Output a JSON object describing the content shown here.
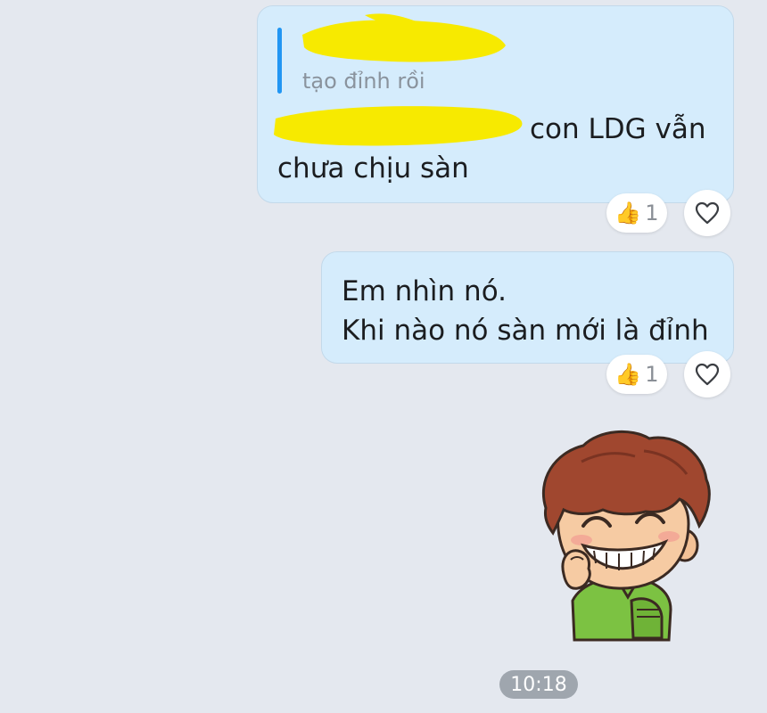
{
  "messages": [
    {
      "quote": {
        "preview_text": "tạo đỉnh rồi"
      },
      "body_lines": [
        "con LDG vẫn",
        "chưa chịu sàn"
      ],
      "reaction": {
        "emoji": "👍",
        "count": "1"
      }
    },
    {
      "body_lines": [
        "Em nhìn nó.",
        "Khi nào nó sàn mới là đỉnh"
      ],
      "reaction": {
        "emoji": "👍",
        "count": "1"
      }
    }
  ],
  "sticker": {
    "icon": "laughing-boy-sticker"
  },
  "timestamp": "10:18",
  "colors": {
    "background": "#e4e8ef",
    "bubble": "#d5ecfc",
    "quote_bar": "#2196f3",
    "redaction": "#f7ea00"
  }
}
